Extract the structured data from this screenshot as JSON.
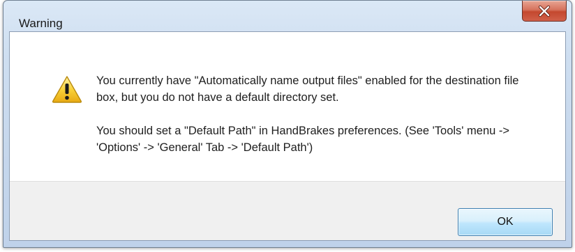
{
  "window": {
    "title": "Warning",
    "close_icon": "close-icon"
  },
  "dialog": {
    "icon": "warning-icon",
    "message_line1": "You currently have \"Automatically name output files\" enabled for the destination file box, but you do not have a default directory set.",
    "message_line2": "You should set a \"Default Path\" in HandBrakes preferences. (See 'Tools' menu -> 'Options' -> 'General' Tab -> 'Default Path')",
    "ok_label": "OK"
  },
  "colors": {
    "close_button": "#c4482e",
    "warning_yellow": "#f5c518",
    "ok_button_border": "#3c7fb1"
  }
}
